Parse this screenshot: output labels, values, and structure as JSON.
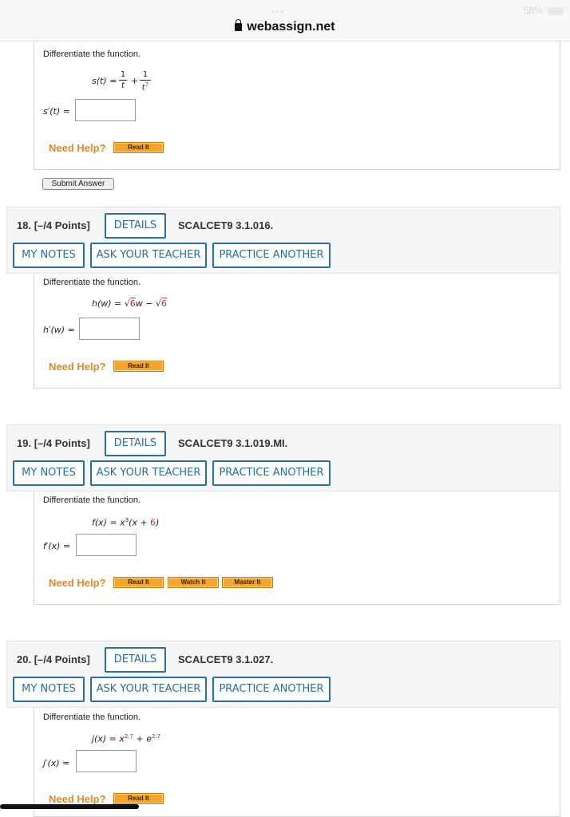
{
  "browser": {
    "url": "webassign.net",
    "battery": "58%"
  },
  "question17": {
    "prompt": "Differentiate the function.",
    "function_lhs": "s(t) =",
    "frac1_num": "1",
    "frac1_den": "t",
    "plus": "+",
    "frac2_num": "1",
    "frac2_den": "t",
    "frac2_exp": "7",
    "answer_label": "s′(t) =",
    "answer_value": "",
    "need_help": "Need Help?",
    "read_it": "Read It",
    "submit": "Submit Answer"
  },
  "questions": [
    {
      "number": "18.",
      "points": "[–/4 Points]",
      "details": "DETAILS",
      "code": "SCALCET9 3.1.016.",
      "my_notes": "MY NOTES",
      "ask_teacher": "ASK YOUR TEACHER",
      "practice": "PRACTICE ANOTHER",
      "prompt": "Differentiate the function.",
      "fn_a": "h(w) = ",
      "fn_b": "w − ",
      "sqrt1": "6",
      "sqrt2": "6",
      "answer_label": "h′(w) =",
      "answer_value": "",
      "need_help": "Need Help?",
      "read_it": "Read It"
    },
    {
      "number": "19.",
      "points": "[–/4 Points]",
      "details": "DETAILS",
      "code": "SCALCET9 3.1.019.MI.",
      "my_notes": "MY NOTES",
      "ask_teacher": "ASK YOUR TEACHER",
      "practice": "PRACTICE ANOTHER",
      "prompt": "Differentiate the function.",
      "fn_a": "f(x) = x",
      "fn_exp": "3",
      "fn_b": "(x + ",
      "fn_red": "6",
      "fn_c": ")",
      "answer_label": "f′(x) =",
      "answer_value": "",
      "need_help": "Need Help?",
      "read_it": "Read It",
      "watch_it": "Watch It",
      "master_it": "Master It"
    },
    {
      "number": "20.",
      "points": "[–/4 Points]",
      "details": "DETAILS",
      "code": "SCALCET9 3.1.027.",
      "my_notes": "MY NOTES",
      "ask_teacher": "ASK YOUR TEACHER",
      "practice": "PRACTICE ANOTHER",
      "prompt": "Differentiate the function.",
      "fn_a": "j(x) = x",
      "fn_exp1": "2.7",
      "fn_b": " + e",
      "fn_exp2": "2.7",
      "answer_label": "j′(x) =",
      "answer_value": "",
      "need_help": "Need Help?",
      "read_it": "Read It"
    }
  ]
}
